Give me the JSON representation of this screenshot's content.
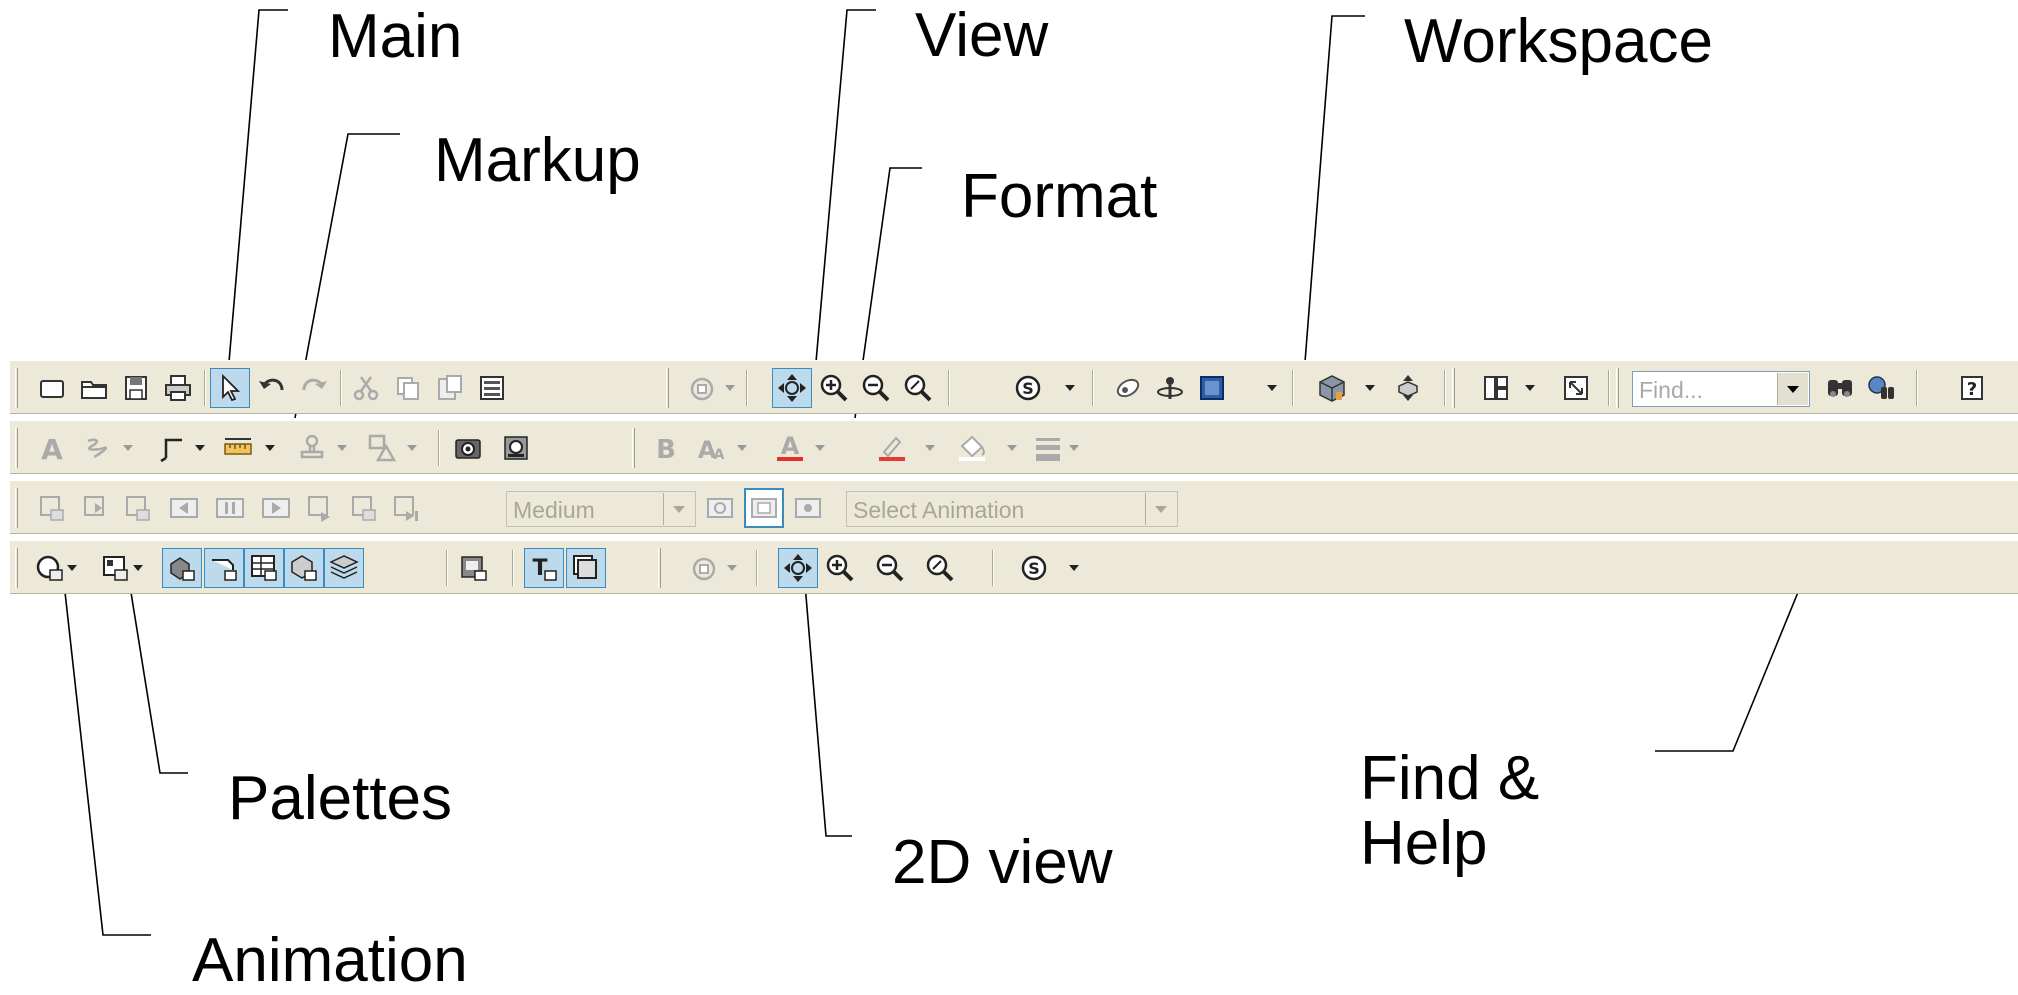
{
  "callouts": {
    "main": "Main",
    "markup": "Markup",
    "view": "View",
    "format": "Format",
    "workspace": "Workspace",
    "palettes": "Palettes",
    "animation": "Animation",
    "view_2d": "2D view",
    "find_help_line1": "Find &",
    "find_help_line2": "Help"
  },
  "toolbar_rows": [
    "Main / View / Workspace / Find & Help",
    "Markup / Format",
    "Animation",
    "Palettes / 2D view"
  ],
  "animation_toolbar": {
    "speed_value": "Medium",
    "animation_select_placeholder": "Select Animation"
  },
  "find_toolbar": {
    "find_placeholder": "Find..."
  },
  "colors": {
    "toolbar_bg": "#ece9d8",
    "active_button_bg": "#bcdaec",
    "active_button_border": "#3a8bc0",
    "font_color_underline": "#e0312b",
    "highlight_underline": "#e53935",
    "model_blue": "#2f5fa8"
  }
}
